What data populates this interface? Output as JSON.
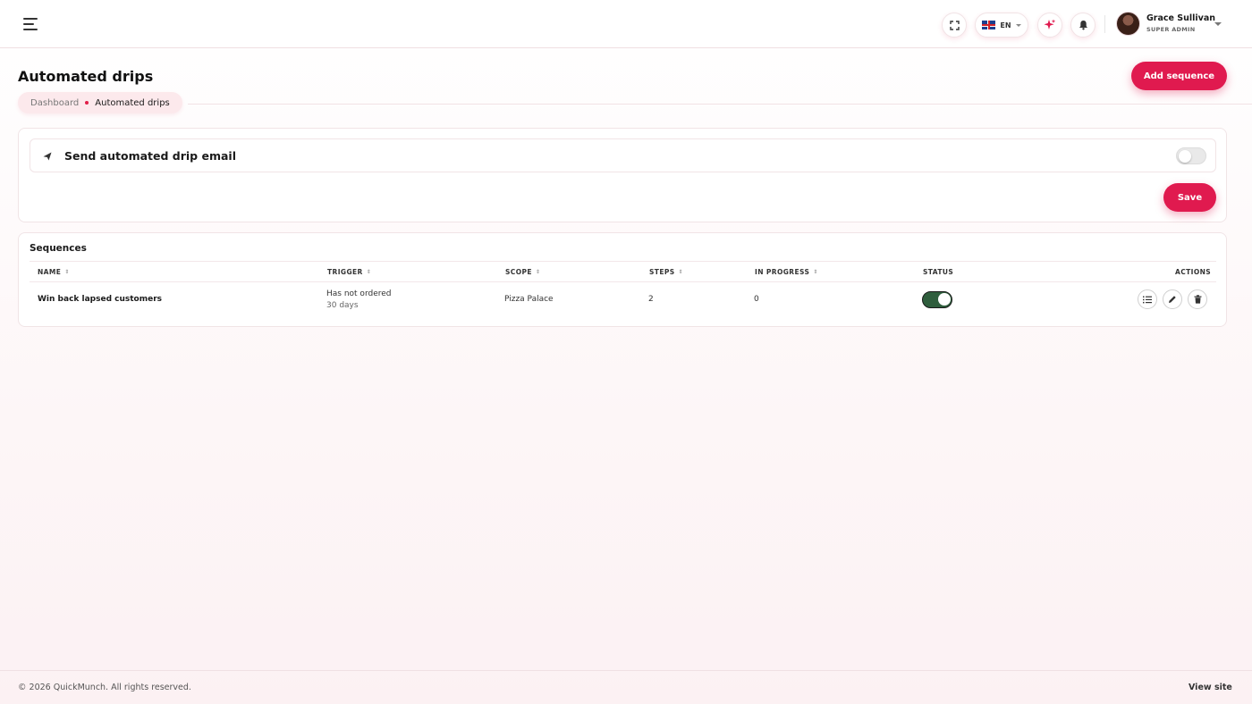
{
  "header": {
    "language": "EN",
    "user": {
      "name": "Grace Sullivan",
      "role": "SUPER ADMIN"
    }
  },
  "page": {
    "title": "Automated drips",
    "add_button": "Add sequence",
    "breadcrumb": {
      "home": "Dashboard",
      "current": "Automated drips"
    }
  },
  "settings": {
    "drip_email_label": "Send automated drip email",
    "drip_email_enabled": false,
    "save_label": "Save"
  },
  "sequences": {
    "title": "Sequences",
    "columns": {
      "name": "NAME",
      "trigger": "TRIGGER",
      "scope": "SCOPE",
      "steps": "STEPS",
      "in_progress": "IN PROGRESS",
      "status": "STATUS",
      "actions": "ACTIONS"
    },
    "rows": [
      {
        "name": "Win back lapsed customers",
        "trigger": "Has not ordered",
        "trigger_detail": "30 days",
        "scope": "Pizza Palace",
        "steps": "2",
        "in_progress": "0",
        "status_enabled": true
      }
    ]
  },
  "footer": {
    "copyright": "© 2026 QuickMunch. All rights reserved.",
    "view_site": "View site"
  },
  "colors": {
    "accent": "#e01a4f",
    "toggle_on": "#2f5e3d",
    "breadcrumb_bg": "#fce9ec"
  }
}
